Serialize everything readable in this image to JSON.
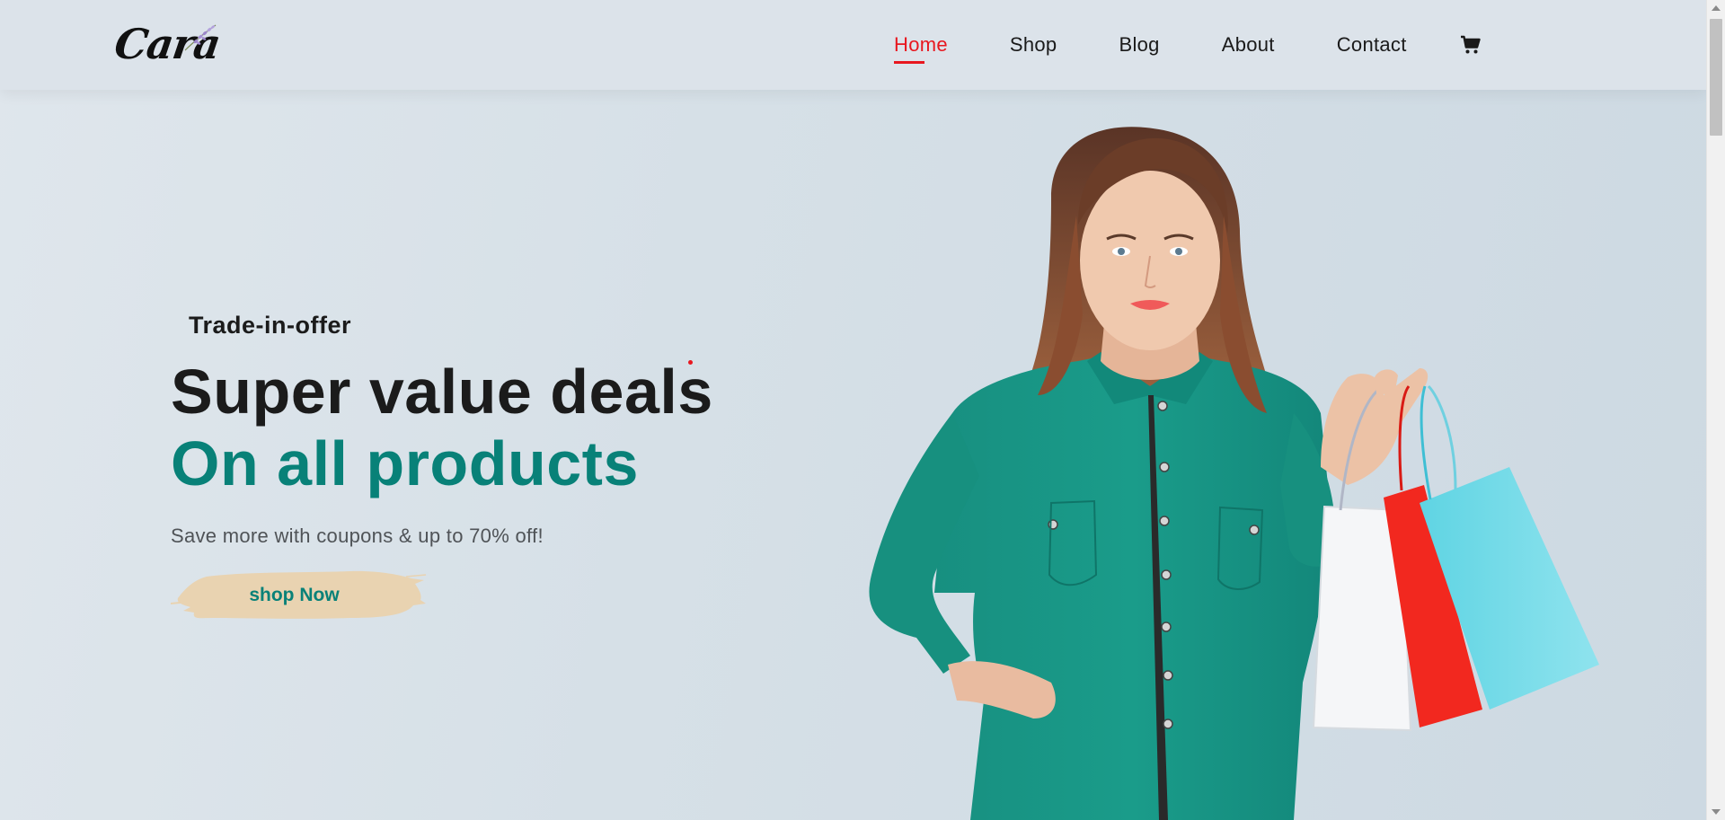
{
  "brand": {
    "name": "Cara"
  },
  "nav": {
    "items": [
      {
        "label": "Home",
        "active": true
      },
      {
        "label": "Shop",
        "active": false
      },
      {
        "label": "Blog",
        "active": false
      },
      {
        "label": "About",
        "active": false
      },
      {
        "label": "Contact",
        "active": false
      }
    ],
    "cart_icon": "cart-icon"
  },
  "hero": {
    "eyebrow": "Trade-in-offer",
    "headline_line1": "Super value deals",
    "headline_line2": "On all products",
    "subtext": "Save more with coupons & up to 70% off!",
    "button_label": "shop Now"
  },
  "colors": {
    "accent_red": "#e8171f",
    "teal": "#088178",
    "button_bg": "#e9d3b1",
    "header_bg": "#dce3ea"
  }
}
